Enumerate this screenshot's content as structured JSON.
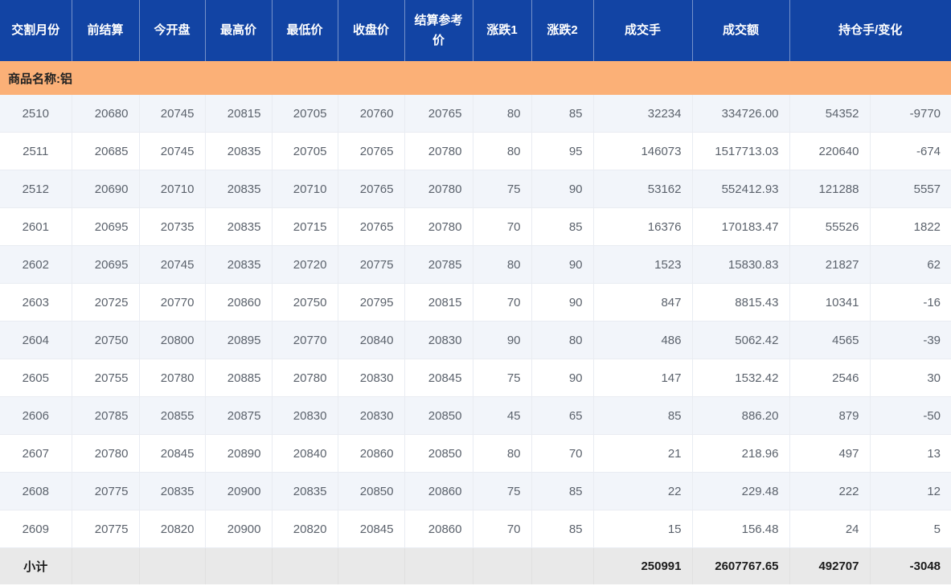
{
  "table": {
    "headers": [
      "交割月份",
      "前结算",
      "今开盘",
      "最高价",
      "最低价",
      "收盘价",
      "结算参考价",
      "涨跌1",
      "涨跌2",
      "成交手",
      "成交额",
      "持仓手/变化"
    ],
    "group_label": "商品名称:铝",
    "rows": [
      [
        "2510",
        "20680",
        "20745",
        "20815",
        "20705",
        "20760",
        "20765",
        "80",
        "85",
        "32234",
        "334726.00",
        "54352",
        "-9770"
      ],
      [
        "2511",
        "20685",
        "20745",
        "20835",
        "20705",
        "20765",
        "20780",
        "80",
        "95",
        "146073",
        "1517713.03",
        "220640",
        "-674"
      ],
      [
        "2512",
        "20690",
        "20710",
        "20835",
        "20710",
        "20765",
        "20780",
        "75",
        "90",
        "53162",
        "552412.93",
        "121288",
        "5557"
      ],
      [
        "2601",
        "20695",
        "20735",
        "20835",
        "20715",
        "20765",
        "20780",
        "70",
        "85",
        "16376",
        "170183.47",
        "55526",
        "1822"
      ],
      [
        "2602",
        "20695",
        "20745",
        "20835",
        "20720",
        "20775",
        "20785",
        "80",
        "90",
        "1523",
        "15830.83",
        "21827",
        "62"
      ],
      [
        "2603",
        "20725",
        "20770",
        "20860",
        "20750",
        "20795",
        "20815",
        "70",
        "90",
        "847",
        "8815.43",
        "10341",
        "-16"
      ],
      [
        "2604",
        "20750",
        "20800",
        "20895",
        "20770",
        "20840",
        "20830",
        "90",
        "80",
        "486",
        "5062.42",
        "4565",
        "-39"
      ],
      [
        "2605",
        "20755",
        "20780",
        "20885",
        "20780",
        "20830",
        "20845",
        "75",
        "90",
        "147",
        "1532.42",
        "2546",
        "30"
      ],
      [
        "2606",
        "20785",
        "20855",
        "20875",
        "20830",
        "20830",
        "20850",
        "45",
        "65",
        "85",
        "886.20",
        "879",
        "-50"
      ],
      [
        "2607",
        "20780",
        "20845",
        "20890",
        "20840",
        "20860",
        "20850",
        "80",
        "70",
        "21",
        "218.96",
        "497",
        "13"
      ],
      [
        "2608",
        "20775",
        "20835",
        "20900",
        "20835",
        "20850",
        "20860",
        "75",
        "85",
        "22",
        "229.48",
        "222",
        "12"
      ],
      [
        "2609",
        "20775",
        "20820",
        "20900",
        "20820",
        "20845",
        "20860",
        "70",
        "85",
        "15",
        "156.48",
        "24",
        "5"
      ]
    ],
    "subtotal": {
      "label": "小计",
      "volume": "250991",
      "turnover": "2607767.65",
      "open_interest": "492707",
      "change": "-3048"
    }
  },
  "colors": {
    "header_bg": "#1244a4",
    "group_row_bg": "#fbb077",
    "stripe_row_bg": "#f2f5fa",
    "subtotal_bg": "#e9e9e9",
    "data_text": "#5b626c"
  }
}
